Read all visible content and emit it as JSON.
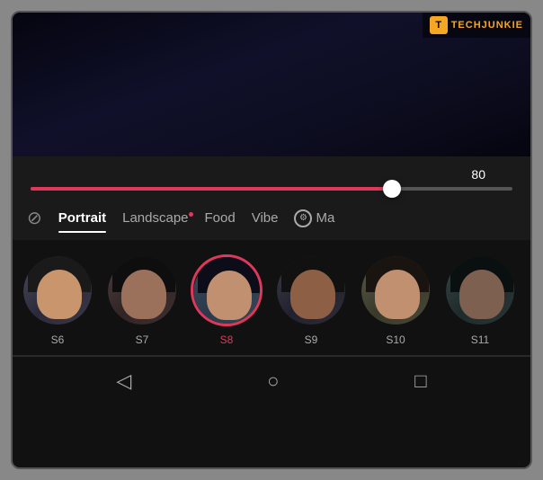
{
  "brand": {
    "logo_text": "T",
    "name": "TECHJUNKIE"
  },
  "slider": {
    "value": "80",
    "fill_percent": 75
  },
  "tabs": [
    {
      "id": "none",
      "label": "⊘",
      "is_icon": true,
      "active": false
    },
    {
      "id": "portrait",
      "label": "Portrait",
      "active": true,
      "has_underline": true
    },
    {
      "id": "landscape",
      "label": "Landscape",
      "active": false,
      "has_dot": true
    },
    {
      "id": "food",
      "label": "Food",
      "active": false
    },
    {
      "id": "vibe",
      "label": "Vibe",
      "active": false
    },
    {
      "id": "ma",
      "label": "Ma",
      "is_gear": true,
      "active": false
    }
  ],
  "filters": [
    {
      "id": "s6",
      "label": "S6",
      "selected": false
    },
    {
      "id": "s7",
      "label": "S7",
      "selected": false
    },
    {
      "id": "s8",
      "label": "S8",
      "selected": true
    },
    {
      "id": "s9",
      "label": "S9",
      "selected": false
    },
    {
      "id": "s10",
      "label": "S10",
      "selected": false
    },
    {
      "id": "s11",
      "label": "S11",
      "selected": false
    }
  ],
  "nav": {
    "back_icon": "◁",
    "home_icon": "○",
    "recent_icon": "□"
  }
}
